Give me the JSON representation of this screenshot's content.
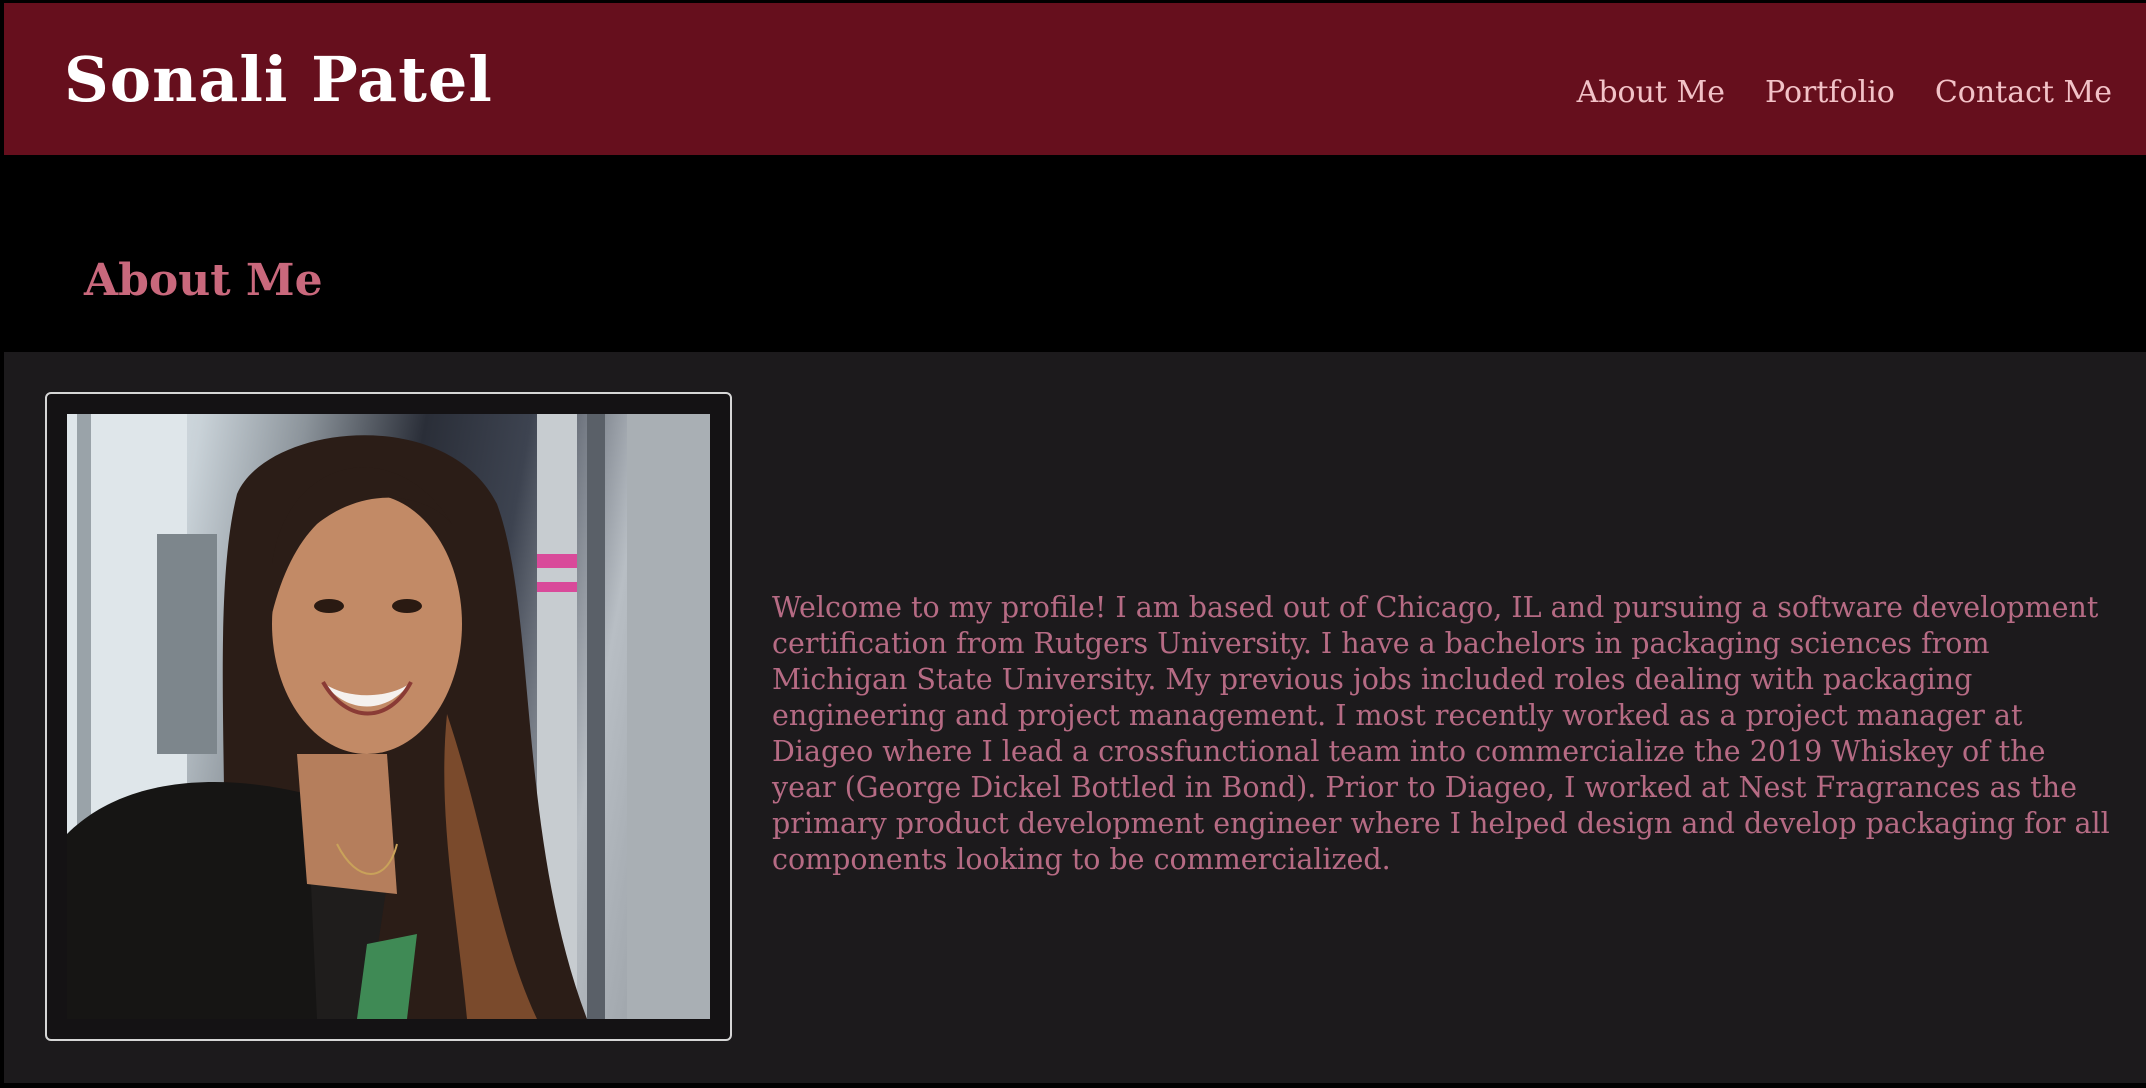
{
  "header": {
    "site_title": "Sonali Patel",
    "nav": [
      {
        "label": "About Me"
      },
      {
        "label": "Portfolio"
      },
      {
        "label": "Contact Me"
      }
    ]
  },
  "about": {
    "heading": "About Me",
    "photo_alt": "Portrait of Sonali Patel smiling",
    "bio": "Welcome to my profile! I am based out of Chicago, IL and pursuing a software development certification from Rutgers University. I have a bachelors in packaging sciences from Michigan State University. My previous jobs included roles dealing with packaging engineering and project management. I most recently worked as a project manager at Diageo where I lead a crossfunctional team into commercialize the 2019 Whiskey of the year (George Dickel Bottled in Bond). Prior to Diageo, I worked at Nest Fragrances as the primary product development engineer where I helped design and develop packaging for all components looking to be commercialized."
  },
  "colors": {
    "header_bg": "#660f1d",
    "page_bg": "#000000",
    "panel_bg": "#1c1a1c",
    "heading": "#c9687c",
    "nav_text": "#f2c2c7",
    "body_text": "#b66b84"
  }
}
